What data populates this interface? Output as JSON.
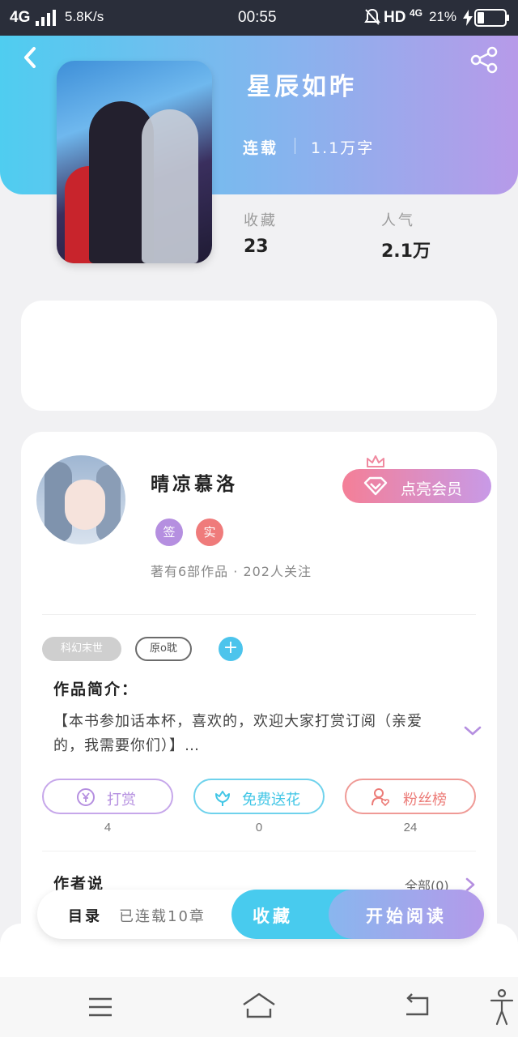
{
  "status_bar": {
    "network": "4G",
    "speed": "5.8K/s",
    "time": "00:55",
    "hd": "HD",
    "net_small": "4G",
    "battery": "21%"
  },
  "book": {
    "title": "星辰如昨",
    "status": "连载",
    "word_count": "1.1万字",
    "favorites_label": "收藏",
    "favorites_value": "23",
    "popularity_label": "人气",
    "popularity_value": "2.1万"
  },
  "author": {
    "name": "晴凉慕洛",
    "badge_signed": "签",
    "badge_verified": "实",
    "meta": "著有6部作品 · 202人关注",
    "vip_label": "点亮会员"
  },
  "tags": [
    "科幻末世",
    "原o耽"
  ],
  "intro": {
    "heading": "作品简介：",
    "text": "【本书参加话本杯，喜欢的，欢迎大家打赏订阅（亲爱的，我需要你们）】…"
  },
  "actions": [
    {
      "label": "打赏",
      "count": "4"
    },
    {
      "label": "免费送花",
      "count": "0"
    },
    {
      "label": "粉丝榜",
      "count": "24"
    }
  ],
  "author_says": {
    "heading": "作者说",
    "all_label": "全部(0)"
  },
  "bottom_bar": {
    "catalog_label": "目录",
    "chapters_label": "已连载10章",
    "favorite_button": "收藏",
    "read_button": "开始阅读"
  },
  "colors": {
    "header_start": "#4fcdf0",
    "header_end": "#b79ae9",
    "accent_blue": "#48cbee",
    "vip_pink": "#f47f97",
    "reward_purple": "#b58fe0",
    "flower_cyan": "#41c6e6",
    "fans_red": "#ec7b77"
  }
}
